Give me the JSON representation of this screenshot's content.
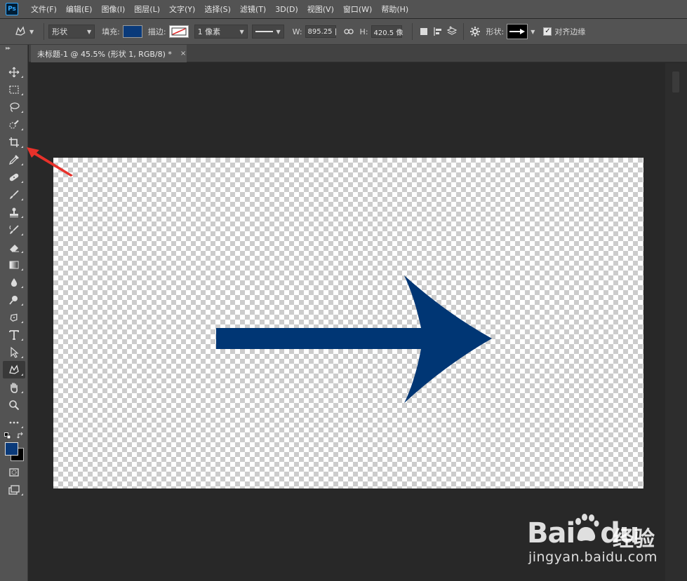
{
  "app": {
    "logo": "Ps"
  },
  "menu": [
    "文件(F)",
    "编辑(E)",
    "图像(I)",
    "图层(L)",
    "文字(Y)",
    "选择(S)",
    "滤镜(T)",
    "3D(D)",
    "视图(V)",
    "窗口(W)",
    "帮助(H)"
  ],
  "options": {
    "tool_mode": "形状",
    "fill_label": "填充:",
    "fill_color": "#0a3a7a",
    "stroke_label": "描边:",
    "stroke_width": "1 像素",
    "w_label": "W:",
    "w_value": "895.25 |",
    "h_label": "H:",
    "h_value": "420.5 像",
    "shape_label": "形状:",
    "align_edges_label": "对齐边缘"
  },
  "document": {
    "tab_title": "未标题-1 @ 45.5% (形状 1, RGB/8) *",
    "close_glyph": "×",
    "shape_color": "#003674"
  },
  "toolbar": {
    "foreground_color": "#0a3a7a",
    "background_color": "#000000"
  },
  "annotation": {
    "color": "#e8312a"
  },
  "watermark": {
    "brand": "Bai",
    "brand2": "du",
    "cn": "经验",
    "url": "jingyan.baidu.com"
  }
}
